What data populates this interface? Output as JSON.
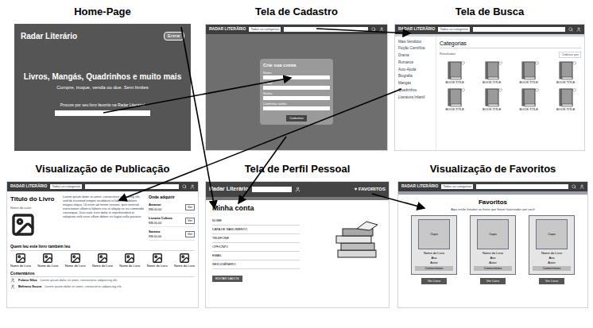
{
  "home": {
    "title": "Home-Page",
    "logo": "Radar Literário",
    "login_button": "Entrar",
    "headline": "Livros, Mangás, Quadrinhos e muito mais",
    "subheadline": "Compre, troque, venda ou doe. Sem limites",
    "search_prompt": "Procure por seu livro favorito na Radar Literário!"
  },
  "cadastro": {
    "title": "Tela de Cadastro",
    "logo": "RADAR LITERÁRIO",
    "search_filter": "Todas as categorias",
    "form_title": "Crie sua conta",
    "fields": [
      "Nome",
      "E-mail",
      "Senha",
      "Confirmar senha"
    ],
    "submit": "Cadastrar"
  },
  "busca": {
    "title": "Tela de Busca",
    "logo": "RADAR LITERÁRIO",
    "search_filter": "Todas as categorias",
    "sidebar": [
      "Mais Vendidos",
      "Ficção Científica",
      "Drama",
      "Romance",
      "Auto-Ajuda",
      "Biografia",
      "Mangás",
      "Quadrinhos",
      "Literatura Infantil"
    ],
    "heading": "Categorias",
    "results_label": "Resultados",
    "sort": "Ordenar por",
    "books": [
      {
        "title": "BOOK TITLE",
        "favorite": false
      },
      {
        "title": "BOOK TITLE",
        "favorite": false
      },
      {
        "title": "BOOK TITLE",
        "favorite": false
      },
      {
        "title": "BOOK TITLE",
        "favorite": false
      },
      {
        "title": "BOOK TITLE",
        "favorite": false
      },
      {
        "title": "BOOK TITLE",
        "favorite": false
      },
      {
        "title": "BOOK TITLE",
        "favorite": false
      },
      {
        "title": "BOOK TITLE",
        "favorite": false
      }
    ]
  },
  "publicacao": {
    "title": "Visualização de Publicação",
    "logo": "RADAR LITERÁRIO",
    "search_filter": "Todas as categorias",
    "book_title": "Titulo do Livro",
    "author": "Nome do autor",
    "description": "Lorem ipsum dolor sit amet, consectetur adipiscing elit, sed do eiusmod tempor incididunt ut labore et dolore magna aliqua. Ut enim ad minim veniam, quis nostrud exercitation ullamco laboris nisi ut aliquip ex ea commodo consequat. Duis aute irure dolor in reprehenderit in voluptate velit esse cillum dolore eu fugiat nulla pariatur.",
    "where_heading": "Onde adquirir",
    "stores": [
      {
        "name": "Amazon",
        "price": "R$ 00,00",
        "button": "Ver"
      },
      {
        "name": "Livraria Cultura",
        "price": "R$ 00,00",
        "button": "Ver"
      },
      {
        "name": "Saraiva",
        "price": "R$ 00,00",
        "button": "Ver"
      }
    ],
    "related_heading": "Quem leu este livro também leu",
    "related": [
      "Nome do Livro",
      "Nome do Livro",
      "Nome do Livro",
      "Nome do Livro",
      "Nome do Livro",
      "Nome do Livro",
      "Nome do Livro"
    ],
    "comments_heading": "Comentários",
    "comments": [
      {
        "author": "Fulano Silva",
        "text": "Lorem ipsum dolor sit amet, consectetur adipiscing elit."
      },
      {
        "author": "Beltrano Souza",
        "text": "Lorem ipsum dolor sit amet, consectetur adipiscing elit."
      }
    ]
  },
  "perfil": {
    "title": "Tela de Perfil Pessoal",
    "logo": "Radar Literário",
    "favorites_icon": "♥",
    "favorites_label": "FAVORITOS",
    "heading": "Minha conta",
    "fields": [
      "NOME",
      "DATA DE NASCIMENTO",
      "TELEFONE",
      "CPF/CNPJ",
      "EMAIL",
      "SEXO/GÊNERO"
    ],
    "edit_button": "EDITAR DADOS"
  },
  "favoritos": {
    "title": "Visualização de Favoritos",
    "logo": "RADAR LITERÁRIO",
    "search_filter": "Todas as categorias",
    "heading": "Favoritos",
    "subheading": "Aqui estão listados os livros que foram favoritados por você",
    "cards": [
      {
        "cover": "Capa",
        "name": "Nome do Livro",
        "year": "Ano",
        "author": "Autor",
        "comments": "Comentários",
        "button": "Ver Livro"
      },
      {
        "cover": "Capa",
        "name": "Nome do Livro",
        "year": "Ano",
        "author": "Autor",
        "comments": "Comentários",
        "button": "Ver Livro"
      },
      {
        "cover": "Capa",
        "name": "Nome do Livro",
        "year": "Ano",
        "author": "Autor",
        "comments": "Comentários",
        "button": "Ver Livro"
      }
    ]
  }
}
